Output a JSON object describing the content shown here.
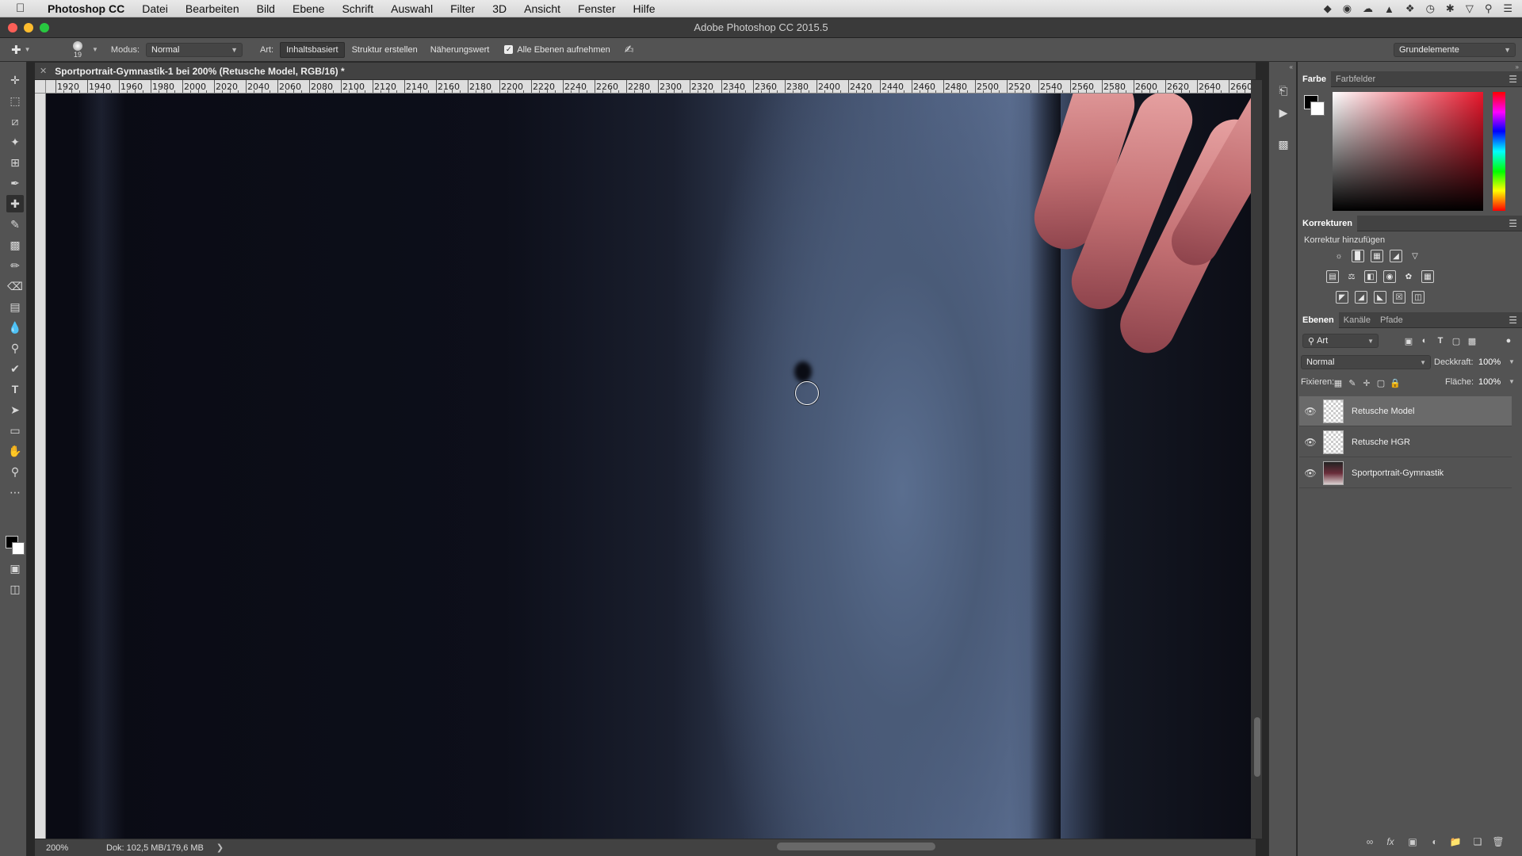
{
  "menubar": {
    "app_name": "Photoshop CC",
    "items": [
      "Datei",
      "Bearbeiten",
      "Bild",
      "Ebene",
      "Schrift",
      "Auswahl",
      "Filter",
      "3D",
      "Ansicht",
      "Fenster",
      "Hilfe"
    ]
  },
  "window": {
    "title": "Adobe Photoshop CC 2015.5"
  },
  "options": {
    "brush_size": "19",
    "mode_label": "Modus:",
    "mode_value": "Normal",
    "type_label": "Art:",
    "type_buttons": [
      "Inhaltsbasiert",
      "Struktur erstellen",
      "Näherungswert"
    ],
    "sample_all_label": "Alle Ebenen aufnehmen",
    "workspace": "Grundelemente"
  },
  "document": {
    "tab_title": "Sportportrait-Gymnastik-1 bei 200% (Retusche Model, RGB/16) *",
    "ruler_ticks": [
      "1920",
      "1940",
      "1960",
      "1980",
      "2000",
      "2020",
      "2040",
      "2060",
      "2080",
      "2100",
      "2120",
      "2140",
      "2160",
      "2180",
      "2200",
      "2220",
      "2240",
      "2260",
      "2280",
      "2300",
      "2320",
      "2340",
      "2360",
      "2380",
      "2400",
      "2420",
      "2440",
      "2460",
      "2480",
      "2500",
      "2520",
      "2540",
      "2560",
      "2580",
      "2600",
      "2620",
      "2640",
      "2660"
    ]
  },
  "status": {
    "zoom": "200%",
    "doc_info": "Dok: 102,5 MB/179,6 MB"
  },
  "color_panel": {
    "tabs": [
      "Farbe",
      "Farbfelder"
    ],
    "fg_color": "#000000",
    "bg_color": "#ffffff"
  },
  "adjustments_panel": {
    "title": "Korrekturen",
    "subtitle": "Korrektur hinzufügen"
  },
  "layers_panel": {
    "tabs": [
      "Ebenen",
      "Kanäle",
      "Pfade"
    ],
    "filter_value": "Art",
    "blend_mode": "Normal",
    "opacity_label": "Deckkraft:",
    "opacity_value": "100%",
    "lock_label": "Fixieren:",
    "fill_label": "Fläche:",
    "fill_value": "100%",
    "layers": [
      {
        "name": "Retusche Model",
        "selected": true
      },
      {
        "name": "Retusche HGR",
        "selected": false
      },
      {
        "name": "Sportportrait-Gymnastik",
        "selected": false
      }
    ]
  },
  "colors": {
    "ui_panel": "#535353",
    "ui_dark": "#424242",
    "selection": "#6a6a6a"
  }
}
